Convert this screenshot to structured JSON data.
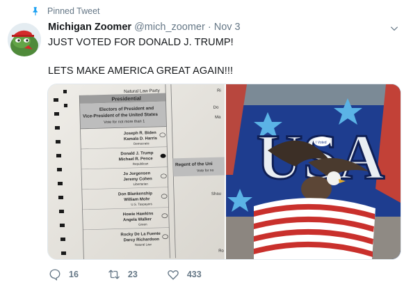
{
  "pinned_label": "Pinned Tweet",
  "user": {
    "name": "Michigan Zoomer",
    "handle": "@mich_zoomer",
    "separator": "·",
    "date": "Nov 3"
  },
  "tweet": {
    "line1": "JUST VOTED FOR DONALD J. TRUMP!",
    "line2": "LETS MAKE AMERICA GREAT AGAIN!!!"
  },
  "ballot": {
    "top_party": "Natural Law Party",
    "header": "Presidential",
    "office": [
      "Electors of President and",
      "Vice-President of the United States"
    ],
    "instruction": "Vote for not more than 1",
    "candidates": [
      {
        "p": "Joseph R. Biden",
        "vp": "Kamala D. Harris",
        "party": "Democratic"
      },
      {
        "p": "Donald J. Trump",
        "vp": "Michael R. Pence",
        "party": "Republican"
      },
      {
        "p": "Jo Jorgensen",
        "vp": "Jeremy Cohen",
        "party": "Libertarian"
      },
      {
        "p": "Don Blankenship",
        "vp": "William Mohr",
        "party": "U.S. Taxpayers"
      },
      {
        "p": "Howie Hawkins",
        "vp": "Angela Walker",
        "party": "Green"
      },
      {
        "p": "Rocky De La Fuente",
        "vp": "Darcy Richardson",
        "party": "Natural Law"
      }
    ],
    "side_header": [
      "Regent of the Uni",
      "Vote for no"
    ],
    "side_names": [
      "Ri",
      "Do",
      "Ma",
      "Shau",
      "Ro"
    ]
  },
  "shirt": {
    "text": "USA",
    "sticker": "I Voted"
  },
  "stats": {
    "replies": "16",
    "retweets": "23",
    "likes": "433"
  },
  "icons": [
    "pin-icon",
    "avatar",
    "chevron-down-icon",
    "reply-icon",
    "retweet-icon",
    "like-icon"
  ],
  "colors": {
    "text": "#14171a",
    "secondary": "#657786",
    "link": "#1da1f2"
  }
}
